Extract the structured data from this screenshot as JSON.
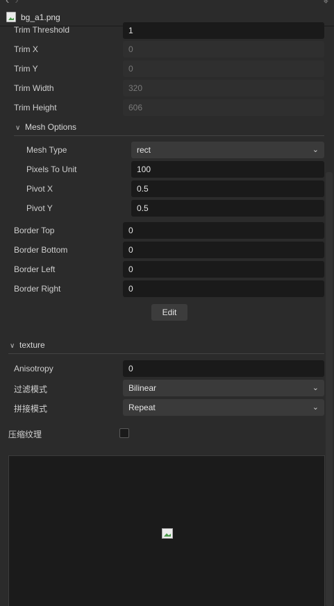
{
  "header": {
    "back_icon": "‹",
    "forward_icon": "›",
    "pin_icon": "⌖",
    "file_name": "bg_a1.png"
  },
  "trim": {
    "threshold": {
      "label": "Trim Threshold",
      "value": "1"
    },
    "x": {
      "label": "Trim X",
      "value": "0"
    },
    "y": {
      "label": "Trim Y",
      "value": "0"
    },
    "width": {
      "label": "Trim Width",
      "value": "320"
    },
    "height": {
      "label": "Trim Height",
      "value": "606"
    }
  },
  "mesh": {
    "title": "Mesh Options",
    "type": {
      "label": "Mesh Type",
      "value": "rect"
    },
    "pixels_to_unit": {
      "label": "Pixels To Unit",
      "value": "100"
    },
    "pivot_x": {
      "label": "Pivot X",
      "value": "0.5"
    },
    "pivot_y": {
      "label": "Pivot Y",
      "value": "0.5"
    }
  },
  "border": {
    "top": {
      "label": "Border Top",
      "value": "0"
    },
    "bottom": {
      "label": "Border Bottom",
      "value": "0"
    },
    "left": {
      "label": "Border Left",
      "value": "0"
    },
    "right": {
      "label": "Border Right",
      "value": "0"
    },
    "edit_label": "Edit"
  },
  "texture": {
    "title": "texture",
    "anisotropy": {
      "label": "Anisotropy",
      "value": "0"
    },
    "filter_mode": {
      "label": "过滤模式",
      "value": "Bilinear"
    },
    "wrap_mode": {
      "label": "拼接模式",
      "value": "Repeat"
    },
    "compress": {
      "label": "压缩纹理",
      "checked": false
    }
  },
  "icons": {
    "chevron_down": "⌄",
    "caret_down": "∨"
  }
}
